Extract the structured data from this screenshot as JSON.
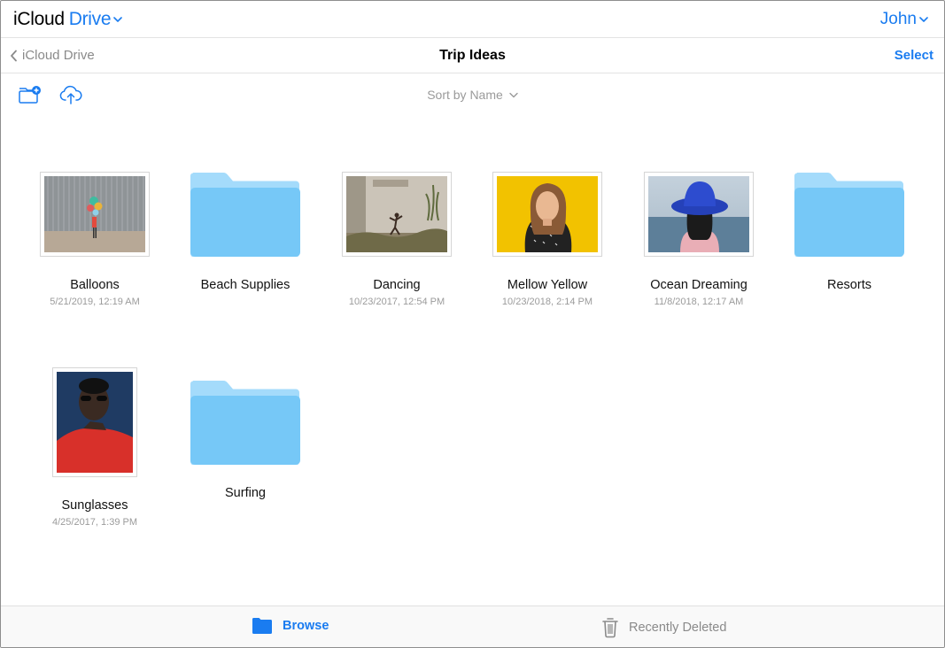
{
  "header": {
    "app_name": "iCloud",
    "app_section": "Drive",
    "user_name": "John"
  },
  "nav": {
    "back_label": "iCloud Drive",
    "title": "Trip Ideas",
    "select_label": "Select"
  },
  "toolbar": {
    "new_folder_icon": "folder-plus-icon",
    "upload_icon": "cloud-upload-icon",
    "sort_label": "Sort by Name"
  },
  "items": [
    {
      "name": "Balloons",
      "date": "5/21/2019, 12:19 AM",
      "type": "photo"
    },
    {
      "name": "Beach Supplies",
      "date": "",
      "type": "folder"
    },
    {
      "name": "Dancing",
      "date": "10/23/2017, 12:54 PM",
      "type": "photo"
    },
    {
      "name": "Mellow Yellow",
      "date": "10/23/2018, 2:14 PM",
      "type": "photo"
    },
    {
      "name": "Ocean Dreaming",
      "date": "11/8/2018, 12:17 AM",
      "type": "photo"
    },
    {
      "name": "Resorts",
      "date": "",
      "type": "folder"
    },
    {
      "name": "Sunglasses",
      "date": "4/25/2017, 1:39 PM",
      "type": "photo"
    },
    {
      "name": "Surfing",
      "date": "",
      "type": "folder"
    }
  ],
  "tabs": {
    "browse_label": "Browse",
    "deleted_label": "Recently Deleted"
  },
  "colors": {
    "accent": "#1a7cf0",
    "folder": "#7fcdf8",
    "muted": "#9a9a9a"
  }
}
